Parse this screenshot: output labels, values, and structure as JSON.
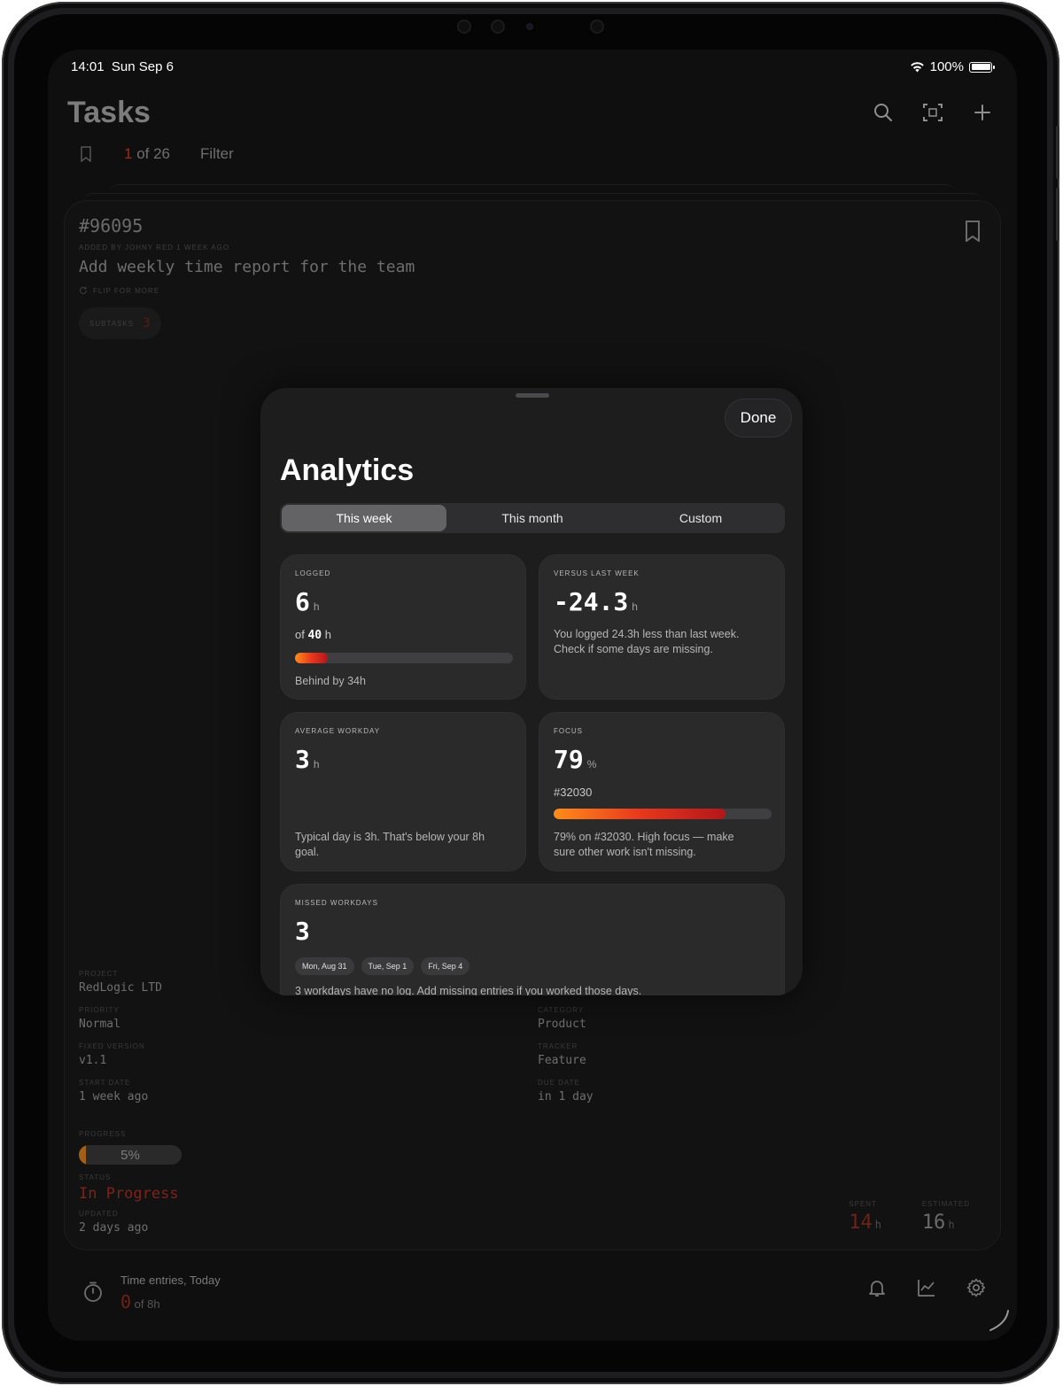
{
  "status_bar": {
    "time": "14:01",
    "date": "Sun Sep 6",
    "battery": "100%"
  },
  "header": {
    "title": "Tasks",
    "count_current": "1",
    "count_rest": " of 26",
    "filter_label": "Filter"
  },
  "task": {
    "id": "#96095",
    "added": "ADDED BY JOHNY RED 1 WEEK AGO",
    "title": "Add weekly time report for the team",
    "flip_hint": "FLIP FOR MORE",
    "subtasks_label": "SUBTASKS",
    "subtasks_count": "3",
    "fields": {
      "project": {
        "label": "PROJECT",
        "value": "RedLogic LTD"
      },
      "priority": {
        "label": "PRIORITY",
        "value": "Normal"
      },
      "category": {
        "label": "CATEGORY",
        "value": "Product"
      },
      "fixed_version": {
        "label": "FIXED VERSION",
        "value": "v1.1"
      },
      "tracker": {
        "label": "TRACKER",
        "value": "Feature"
      },
      "start_date": {
        "label": "START DATE",
        "value": "1 week ago"
      },
      "due_date": {
        "label": "DUE DATE",
        "value": "in 1 day"
      },
      "progress": {
        "label": "PROGRESS",
        "value": "5%",
        "fraction": 0.05
      },
      "status": {
        "label": "STATUS",
        "value": "In Progress"
      },
      "updated": {
        "label": "UPDATED",
        "value": "2 days ago"
      }
    },
    "spent": {
      "label": "SPENT",
      "value": "14",
      "unit": "h"
    },
    "estimated": {
      "label": "ESTIMATED",
      "value": "16",
      "unit": "h"
    }
  },
  "bottom_bar": {
    "title": "Time entries, Today",
    "value": "0",
    "of": "of 8h"
  },
  "analytics": {
    "title": "Analytics",
    "done_label": "Done",
    "tabs": [
      {
        "label": "This week",
        "active": true
      },
      {
        "label": "This month",
        "active": false
      },
      {
        "label": "Custom",
        "active": false
      }
    ],
    "logged": {
      "label": "LOGGED",
      "value": "6",
      "unit": "h",
      "of_prefix": "of",
      "of_value": "40",
      "of_unit": "h",
      "fraction": 0.15,
      "note": "Behind by 34h"
    },
    "versus": {
      "label": "VERSUS LAST WEEK",
      "value": "-24.3",
      "unit": "h",
      "note": "You logged 24.3h less than last week. Check if some days are missing."
    },
    "average": {
      "label": "AVERAGE WORKDAY",
      "value": "3",
      "unit": "h",
      "note": "Typical day is 3h. That's below your 8h goal."
    },
    "focus": {
      "label": "FOCUS",
      "value": "79",
      "unit": "%",
      "task": "#32030",
      "fraction": 0.79,
      "note": "79% on #32030. High focus — make sure other work isn't missing."
    },
    "missed": {
      "label": "MISSED WORKDAYS",
      "value": "3",
      "days": [
        "Mon, Aug 31",
        "Tue, Sep 1",
        "Fri, Sep 4"
      ],
      "note": "3 workdays have no log. Add missing entries if you worked those days."
    }
  },
  "colors": {
    "accent_red": "#a02a1b",
    "bar_start": "#ff8c1a",
    "bar_end": "#b3161a"
  }
}
